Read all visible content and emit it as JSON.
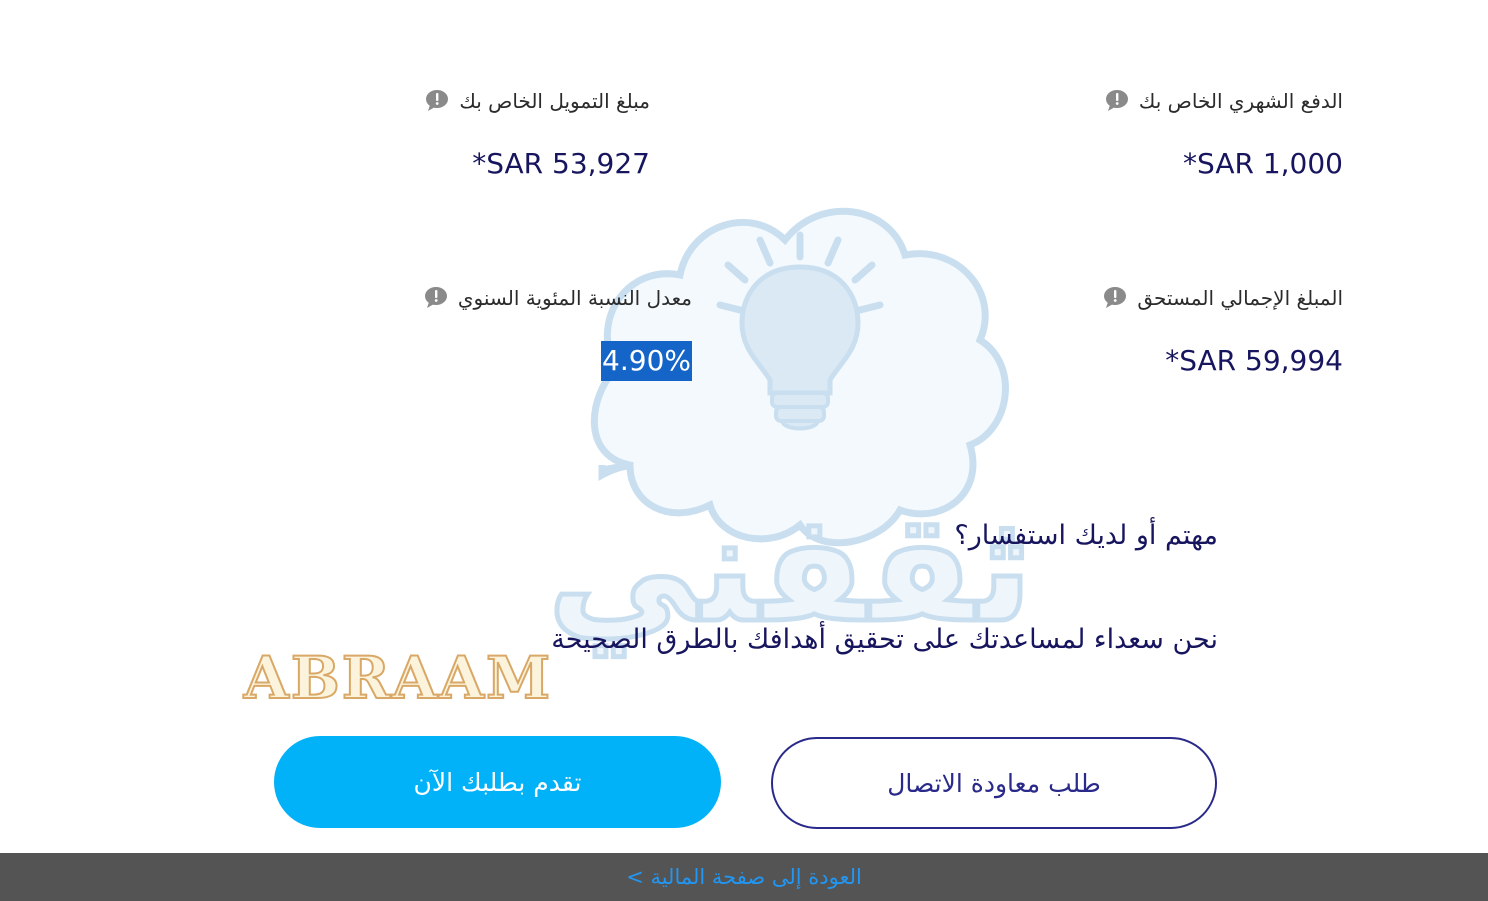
{
  "results": {
    "monthly_payment": {
      "label": "الدفع الشهري الخاص بك",
      "value": "*SAR 1,000"
    },
    "finance_amount": {
      "label": "مبلغ التمويل الخاص بك",
      "value": "*SAR 53,927"
    },
    "total_due": {
      "label": "المبلغ الإجمالي المستحق",
      "value": "*SAR 59,994"
    },
    "apr": {
      "label": "معدل النسبة المئوية السنوي",
      "value": "4.90%"
    }
  },
  "enquiry": {
    "title": "مهتم أو لديك استفسار؟",
    "text": "نحن سعداء لمساعدتك على تحقيق أهدافك بالطرق الصحيحة"
  },
  "buttons": {
    "callback": "طلب معاودة الاتصال",
    "apply": "تقدم بطلبك الآن"
  },
  "footer": {
    "back_link": "العودة إلى صفحة المالية >"
  },
  "overlay": {
    "watermark_text": "ثقفني",
    "signature_text": "ABRAAM"
  },
  "icons": {
    "info": "info-bubble-icon",
    "watermark": "lightbulb-icon"
  },
  "colors": {
    "navy_text": "#17155e",
    "accent_blue": "#02b2f8",
    "highlight": "#1565c8",
    "footer_bg": "#545454",
    "link": "#2196f3"
  }
}
